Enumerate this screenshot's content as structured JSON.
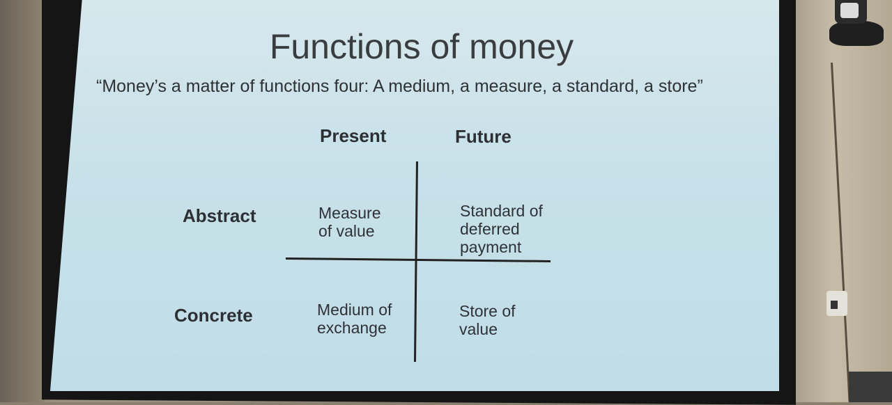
{
  "slide": {
    "title": "Functions of money",
    "quote": "“Money’s a matter of functions four: A medium, a measure, a standard, a store”",
    "columns": [
      "Present",
      "Future"
    ],
    "rows": [
      "Abstract",
      "Concrete"
    ],
    "cells": {
      "abstract_present": "Measure\nof value",
      "abstract_future": "Standard of\ndeferred\npayment",
      "concrete_present": "Medium of\nexchange",
      "concrete_future": "Store of\nvalue"
    }
  },
  "colors": {
    "screen": "#c9e1e9",
    "text": "#2e3134",
    "frame": "#151515"
  }
}
